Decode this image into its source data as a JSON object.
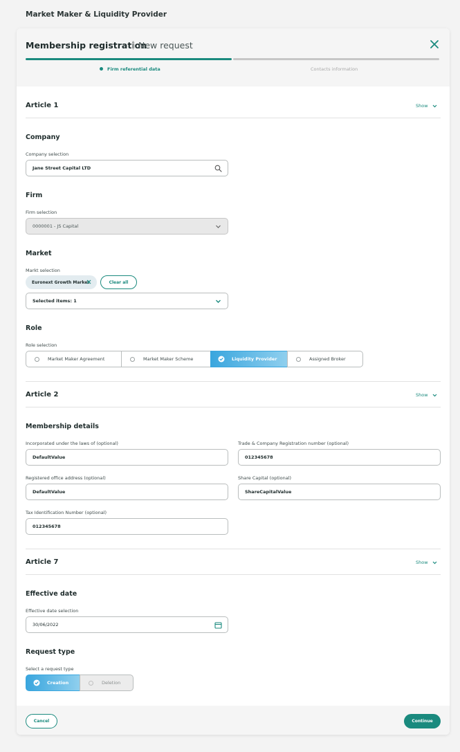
{
  "app": {
    "title": "Market Maker & Liquidity Provider"
  },
  "modal": {
    "title": "Membership registration",
    "subtitle": "New request"
  },
  "steps": [
    {
      "label": "Firm referential data",
      "state": "active"
    },
    {
      "label": "Contacts information",
      "state": "inactive"
    }
  ],
  "show_label": "Show",
  "articles": {
    "a1": "Article 1",
    "a2": "Article 2",
    "a7": "Article 7"
  },
  "company": {
    "title": "Company",
    "label": "Company selection",
    "value": "Jane Street Capital LTD",
    "icon": "search-icon"
  },
  "firm": {
    "title": "Firm",
    "label": "Firm selection",
    "value": "0000001 - JS Capital",
    "disabled": true
  },
  "market": {
    "title": "Market",
    "label": "Markt selection",
    "chips": [
      "Euronext Growth Market"
    ],
    "clear_label": "Clear all",
    "dropdown_value": "Selected items: 1"
  },
  "role": {
    "title": "Role",
    "label": "Role selection",
    "options": [
      "Market Maker Agreement",
      "Market Maker Scheme",
      "Liquidity Provider",
      "Assigned Broker"
    ],
    "selected": "Liquidity Provider"
  },
  "membership": {
    "title": "Membership details",
    "laws_label": "Incorporated under the laws of (optional)",
    "laws_value": "DefaultValue",
    "reg_label": "Trade & Company Registration number (optional)",
    "reg_value": "012345678",
    "office_label": "Registered office address (optional)",
    "office_value": "DefaultValue",
    "capital_label": "Share Capital (optional)",
    "capital_value": "ShareCapitalValue",
    "tax_label": "Tax Identification Number (optional)",
    "tax_value": "012345678"
  },
  "effective": {
    "title": "Effective date",
    "label": "Effective date selection",
    "value": "30/06/2022"
  },
  "request": {
    "title": "Request type",
    "label": "Select a request type",
    "options": [
      "Creation",
      "Deletion"
    ],
    "selected": "Creation"
  },
  "footer": {
    "cancel": "Cancel",
    "continue": "Continue"
  },
  "colors": {
    "accent": "#1a8a7e",
    "selected_gradient_start": "#3aa6de",
    "selected_gradient_end": "#8fcfee"
  }
}
